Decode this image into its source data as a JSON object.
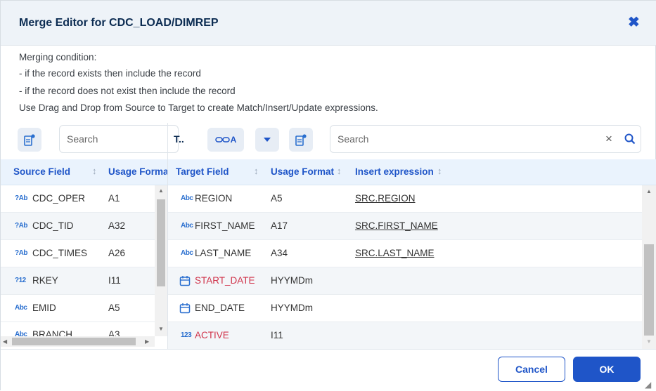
{
  "dialog": {
    "title": "Merge Editor for CDC_LOAD/DIMREP",
    "close_label": "✖"
  },
  "condition": {
    "heading": "Merging condition:",
    "line1": "- if the record exists then include the record",
    "line2": "- if the record does not exist then include the record",
    "instruction": "Use Drag and Drop from Source to Target to create Match/Insert/Update expressions."
  },
  "left_toolbar": {
    "search_placeholder": "Search"
  },
  "right_toolbar": {
    "t_label": "T..",
    "toggle_label": "A",
    "search_placeholder": "Search",
    "clear_label": "×"
  },
  "source": {
    "headers": [
      "Source Field",
      "Usage Forma"
    ],
    "rows": [
      {
        "icon": "?Ab",
        "name": "CDC_OPER",
        "usage": "A1"
      },
      {
        "icon": "?Ab",
        "name": "CDC_TID",
        "usage": "A32"
      },
      {
        "icon": "?Ab",
        "name": "CDC_TIMES",
        "usage": "A26"
      },
      {
        "icon": "?12",
        "name": "RKEY",
        "usage": "I11"
      },
      {
        "icon": "Abc",
        "name": "EMID",
        "usage": "A5"
      },
      {
        "icon": "Abc",
        "name": "BRANCH",
        "usage": "A3"
      }
    ]
  },
  "target": {
    "headers": [
      "Target Field",
      "Usage Format",
      "Insert expression"
    ],
    "rows": [
      {
        "icon": "Abc",
        "name": "REGION",
        "usage": "A5",
        "expr": "SRC.REGION",
        "highlight": false
      },
      {
        "icon": "Abc",
        "name": "FIRST_NAME",
        "usage": "A17",
        "expr": "SRC.FIRST_NAME",
        "highlight": false
      },
      {
        "icon": "Abc",
        "name": "LAST_NAME",
        "usage": "A34",
        "expr": "SRC.LAST_NAME",
        "highlight": false
      },
      {
        "icon": "calendar",
        "name": "START_DATE",
        "usage": "HYYMDm",
        "expr": "",
        "highlight": true
      },
      {
        "icon": "calendar",
        "name": "END_DATE",
        "usage": "HYYMDm",
        "expr": "",
        "highlight": false
      },
      {
        "icon": "123",
        "name": "ACTIVE",
        "usage": "I11",
        "expr": "",
        "highlight": true
      }
    ]
  },
  "footer": {
    "cancel_label": "Cancel",
    "ok_label": "OK"
  },
  "colors": {
    "accent": "#1f55c8",
    "required_field": "#d0334a",
    "header_bg": "#eaf3fd"
  }
}
